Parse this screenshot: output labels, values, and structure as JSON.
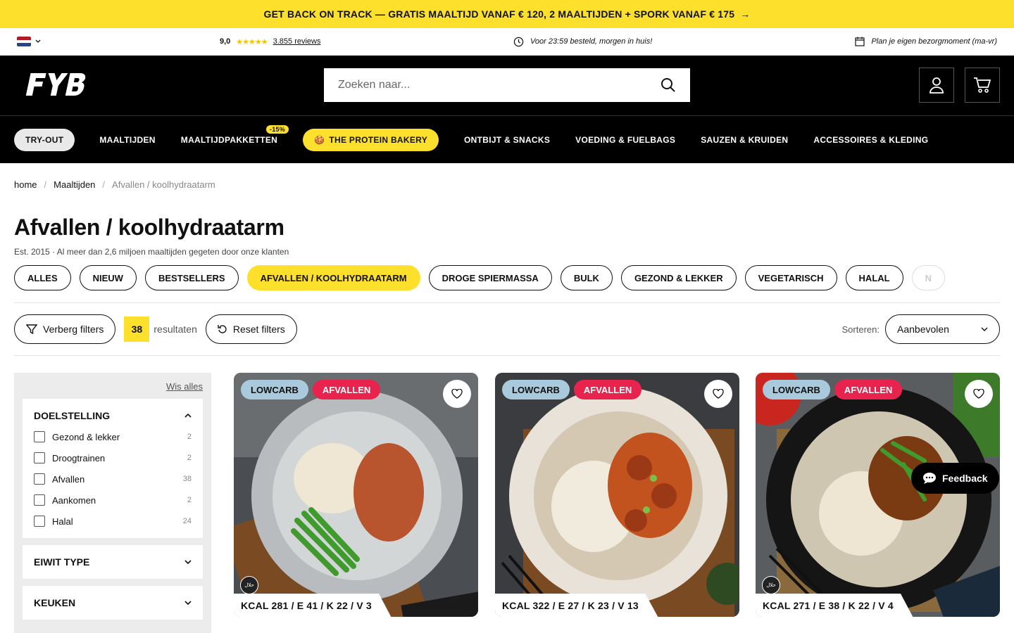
{
  "promo": {
    "text": "GET BACK ON TRACK — GRATIS MAALTIJD VANAF € 120, 2 MAALTIJDEN + SPORK VANAF € 175",
    "arrow": "→"
  },
  "topbar": {
    "rating_score": "9,0",
    "stars": "★★★★★",
    "reviews_link": "3.855 reviews",
    "delivery_text": "Voor 23:59 besteld, morgen in huis!",
    "plan_text": "Plan je eigen bezorgmoment (ma-vr)"
  },
  "header": {
    "search_placeholder": "Zoeken naar..."
  },
  "nav": {
    "tryout": "TRY-OUT",
    "maaltijden": "MAALTIJDEN",
    "pakketten": "MAALTIJDPAKKETTEN",
    "pakketten_badge": "-15%",
    "bakery_emoji": "🍪",
    "bakery": "THE PROTEIN BAKERY",
    "ontbijt": "ONTBIJT & SNACKS",
    "voeding": "VOEDING & FUELBAGS",
    "sauzen": "SAUZEN & KRUIDEN",
    "accessoires": "ACCESSOIRES & KLEDING"
  },
  "breadcrumb": {
    "home": "home",
    "sep": "/",
    "maaltijden": "Maaltijden",
    "current": "Afvallen / koolhydraatarm"
  },
  "page": {
    "title": "Afvallen / koolhydraatarm",
    "subtitle": "Est. 2015 · Al meer dan 2,6 miljoen maaltijden gegeten door onze klanten"
  },
  "categories": [
    "ALLES",
    "NIEUW",
    "BESTSELLERS",
    "AFVALLEN / KOOLHYDRAATARM",
    "DROGE SPIERMASSA",
    "BULK",
    "GEZOND & LEKKER",
    "VEGETARISCH",
    "HALAL",
    "N"
  ],
  "filterbar": {
    "hide_filters": "Verberg filters",
    "count": "38",
    "results_label": "resultaten",
    "reset": "Reset filters",
    "sort_label": "Sorteren:",
    "sort_value": "Aanbevolen"
  },
  "sidebar": {
    "clear_all": "Wis alles",
    "goal_title": "DOELSTELLING",
    "goal_options": [
      {
        "label": "Gezond & lekker",
        "count": "2"
      },
      {
        "label": "Droogtrainen",
        "count": "2"
      },
      {
        "label": "Afvallen",
        "count": "38"
      },
      {
        "label": "Aankomen",
        "count": "2"
      },
      {
        "label": "Halal",
        "count": "24"
      }
    ],
    "protein_title": "EIWIT TYPE",
    "kitchen_title": "KEUKEN"
  },
  "products": [
    {
      "tag1": "LOWCARB",
      "tag2": "AFVALLEN",
      "macros": "KCAL 281 / E 41 / K 22 / V 3",
      "halal": true
    },
    {
      "tag1": "LOWCARB",
      "tag2": "AFVALLEN",
      "macros": "KCAL 322 / E 27 / K 23 / V 13",
      "halal": false
    },
    {
      "tag1": "LOWCARB",
      "tag2": "AFVALLEN",
      "macros": "KCAL 271 / E 38 / K 22 / V 4",
      "halal": true
    }
  ],
  "feedback": "Feedback",
  "colors": {
    "accent_yellow": "#fde02b",
    "tag_blue": "#a9c9dc",
    "tag_red": "#e8234e",
    "header_black": "#000000"
  }
}
